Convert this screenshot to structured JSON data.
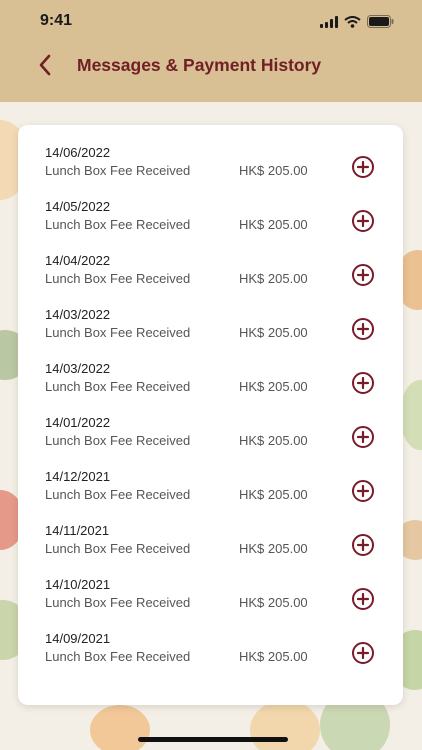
{
  "status_bar": {
    "time": "9:41",
    "icons": [
      "signal-icon",
      "wifi-icon",
      "battery-icon"
    ]
  },
  "header": {
    "title": "Messages & Payment History",
    "back_icon": "chevron-left-icon"
  },
  "colors": {
    "header_bg": "#d8bf94",
    "title": "#6f1f25",
    "accent": "#7a1b2a"
  },
  "records": [
    {
      "date": "14/06/2022",
      "description": "Lunch Box Fee Received",
      "amount": "HK$ 205.00"
    },
    {
      "date": "14/05/2022",
      "description": "Lunch Box Fee Received",
      "amount": "HK$ 205.00"
    },
    {
      "date": "14/04/2022",
      "description": "Lunch Box Fee Received",
      "amount": "HK$ 205.00"
    },
    {
      "date": "14/03/2022",
      "description": "Lunch Box Fee Received",
      "amount": "HK$ 205.00"
    },
    {
      "date": "14/03/2022",
      "description": "Lunch Box Fee Received",
      "amount": "HK$ 205.00"
    },
    {
      "date": "14/01/2022",
      "description": "Lunch Box Fee Received",
      "amount": "HK$ 205.00"
    },
    {
      "date": "14/12/2021",
      "description": "Lunch Box Fee Received",
      "amount": "HK$ 205.00"
    },
    {
      "date": "14/11/2021",
      "description": "Lunch Box Fee Received",
      "amount": "HK$ 205.00"
    },
    {
      "date": "14/10/2021",
      "description": "Lunch Box Fee Received",
      "amount": "HK$ 205.00"
    },
    {
      "date": "14/09/2021",
      "description": "Lunch Box Fee Received",
      "amount": "HK$ 205.00"
    }
  ]
}
